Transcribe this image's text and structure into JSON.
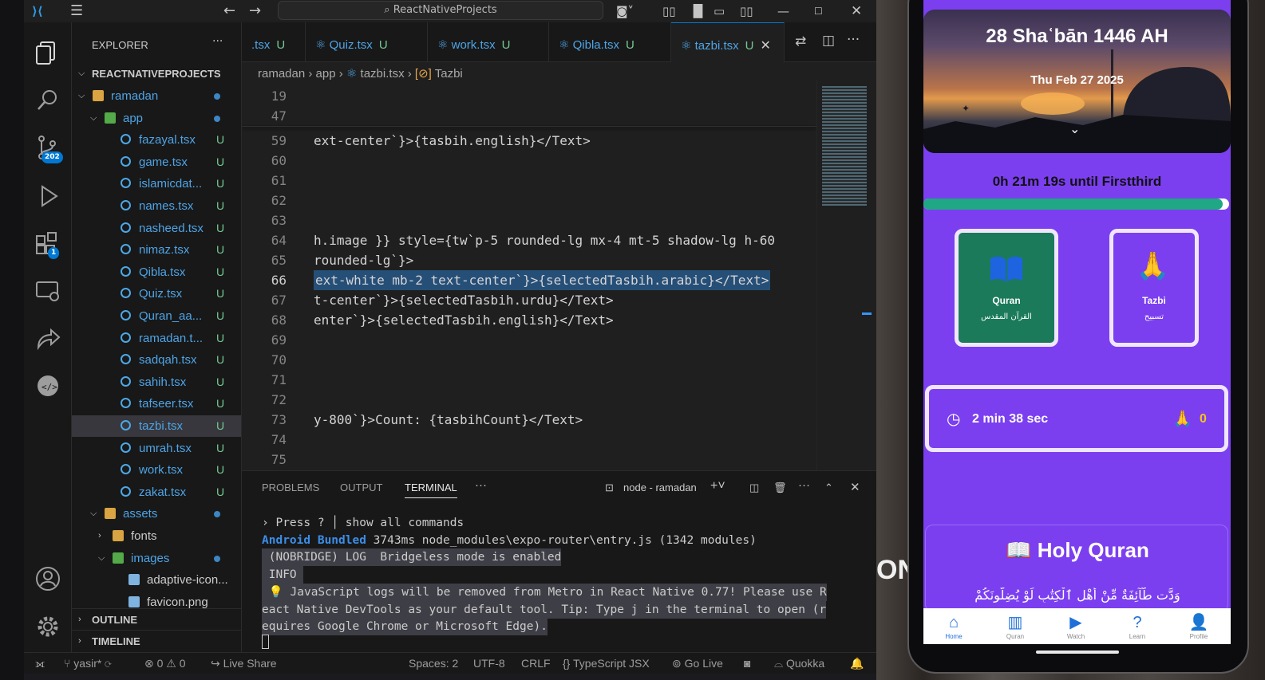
{
  "titlebar": {
    "search": "ReactNativeProjects"
  },
  "activity_badges": {
    "scm": "202",
    "extensions": "1"
  },
  "explorer": {
    "title": "EXPLORER",
    "root": "REACTNATIVEPROJECTS",
    "items": [
      {
        "label": "ramadan",
        "kind": "folder",
        "status": "dot"
      },
      {
        "label": "app",
        "kind": "gfolder",
        "status": "dot"
      },
      {
        "label": "fazayal.tsx",
        "kind": "tsx",
        "status": "U"
      },
      {
        "label": "game.tsx",
        "kind": "tsx",
        "status": "U"
      },
      {
        "label": "islamicdat...",
        "kind": "tsx",
        "status": "U"
      },
      {
        "label": "names.tsx",
        "kind": "tsx",
        "status": "U"
      },
      {
        "label": "nasheed.tsx",
        "kind": "tsx",
        "status": "U"
      },
      {
        "label": "nimaz.tsx",
        "kind": "tsx",
        "status": "U"
      },
      {
        "label": "Qibla.tsx",
        "kind": "tsx",
        "status": "U"
      },
      {
        "label": "Quiz.tsx",
        "kind": "tsx",
        "status": "U"
      },
      {
        "label": "Quran_aa...",
        "kind": "tsx",
        "status": "U"
      },
      {
        "label": "ramadan.t...",
        "kind": "tsx",
        "status": "U"
      },
      {
        "label": "sadqah.tsx",
        "kind": "tsx",
        "status": "U"
      },
      {
        "label": "sahih.tsx",
        "kind": "tsx",
        "status": "U"
      },
      {
        "label": "tafseer.tsx",
        "kind": "tsx",
        "status": "U"
      },
      {
        "label": "tazbi.tsx",
        "kind": "tsx",
        "status": "U"
      },
      {
        "label": "umrah.tsx",
        "kind": "tsx",
        "status": "U"
      },
      {
        "label": "work.tsx",
        "kind": "tsx",
        "status": "U"
      },
      {
        "label": "zakat.tsx",
        "kind": "tsx",
        "status": "U"
      },
      {
        "label": "assets",
        "kind": "folder",
        "status": "dot"
      },
      {
        "label": "fonts",
        "kind": "folder",
        "status": ""
      },
      {
        "label": "images",
        "kind": "gfolder",
        "status": "dot"
      },
      {
        "label": "adaptive-icon...",
        "kind": "img",
        "status": ""
      },
      {
        "label": "favicon.png",
        "kind": "img",
        "status": ""
      }
    ],
    "outline": "OUTLINE",
    "timeline": "TIMELINE"
  },
  "tabs": [
    {
      "label": ".tsx",
      "status": "U"
    },
    {
      "label": "Quiz.tsx",
      "status": "U"
    },
    {
      "label": "work.tsx",
      "status": "U"
    },
    {
      "label": "Qibla.tsx",
      "status": "U"
    },
    {
      "label": "tazbi.tsx",
      "status": "U"
    }
  ],
  "breadcrumb": {
    "p1": "ramadan",
    "p2": "app",
    "p3": "tazbi.tsx",
    "p4": "Tazbi"
  },
  "editor": {
    "lines": [
      {
        "n": "19",
        "t": ""
      },
      {
        "n": "47",
        "t": ""
      },
      {
        "n": "59",
        "t": "ext-center`}>{tasbih.english}</Text>"
      },
      {
        "n": "60",
        "t": ""
      },
      {
        "n": "61",
        "t": ""
      },
      {
        "n": "62",
        "t": ""
      },
      {
        "n": "63",
        "t": ""
      },
      {
        "n": "64",
        "t": "h.image }} style={tw`p-5 rounded-lg mx-4 mt-5 shadow-lg h-60"
      },
      {
        "n": "65",
        "t": "rounded-lg`}>"
      },
      {
        "n": "66",
        "t": "ext-white mb-2 text-center`}>{selectedTasbih.arabic}</Text>"
      },
      {
        "n": "67",
        "t": "t-center`}>{selectedTasbih.urdu}</Text>"
      },
      {
        "n": "68",
        "t": "enter`}>{selectedTasbih.english}</Text>"
      },
      {
        "n": "69",
        "t": ""
      },
      {
        "n": "70",
        "t": ""
      },
      {
        "n": "71",
        "t": ""
      },
      {
        "n": "72",
        "t": ""
      },
      {
        "n": "73",
        "t": "y-800`}>Count: {tasbihCount}</Text>"
      },
      {
        "n": "74",
        "t": ""
      },
      {
        "n": "75",
        "t": ""
      }
    ]
  },
  "panel": {
    "tabs": [
      "PROBLEMS",
      "OUTPUT",
      "TERMINAL"
    ],
    "terminal_name": "node - ramadan",
    "lines": [
      "› Press ? │ show all commands",
      "Android Bundled 3743ms node_modules\\expo-router\\entry.js (1342 modules)",
      " (NOBRIDGE) LOG  Bridgeless mode is enabled",
      " INFO ",
      " 💡 JavaScript logs will be removed from Metro in React Native 0.77! Please use R",
      "eact Native DevTools as your default tool. Tip: Type j in the terminal to open (r",
      "equires Google Chrome or Microsoft Edge)."
    ]
  },
  "statusbar": {
    "branch": "yasir*",
    "errors": "0",
    "warnings": "0",
    "liveshare": "Live Share",
    "spaces": "Spaces: 2",
    "encoding": "UTF-8",
    "eol": "CRLF",
    "language": "TypeScript JSX",
    "golive": "Go Live",
    "quokka": "Quokka"
  },
  "phone": {
    "hijri_date": "28 Shaʿbān 1446 AH",
    "greg_date": "Thu Feb 27 2025",
    "countdown": "0h 21m 19s until Firstthird",
    "progress": 0.98,
    "cards": [
      {
        "title": "Quran",
        "subtitle": "القرآن المقدس"
      },
      {
        "title": "Tazbi",
        "subtitle": "تسبیح"
      }
    ],
    "timer": "2 min 38 sec",
    "count": "0",
    "section_title": "📖 Holy Quran",
    "arabic_line": "وَدَّت طَّآئِفَةٌ مِّنْ أَهْلِ ٱلْكِتَٰبِ لَوْ يُضِلُّونَكُمْ",
    "nav": [
      "Home",
      "Quran",
      "Watch",
      "Learn",
      "Profile"
    ]
  },
  "colors": {
    "accent": "#0078d4",
    "app_purple": "#7b3ff0",
    "card_green": "#1b7a5a",
    "gold": "#f5c518"
  }
}
